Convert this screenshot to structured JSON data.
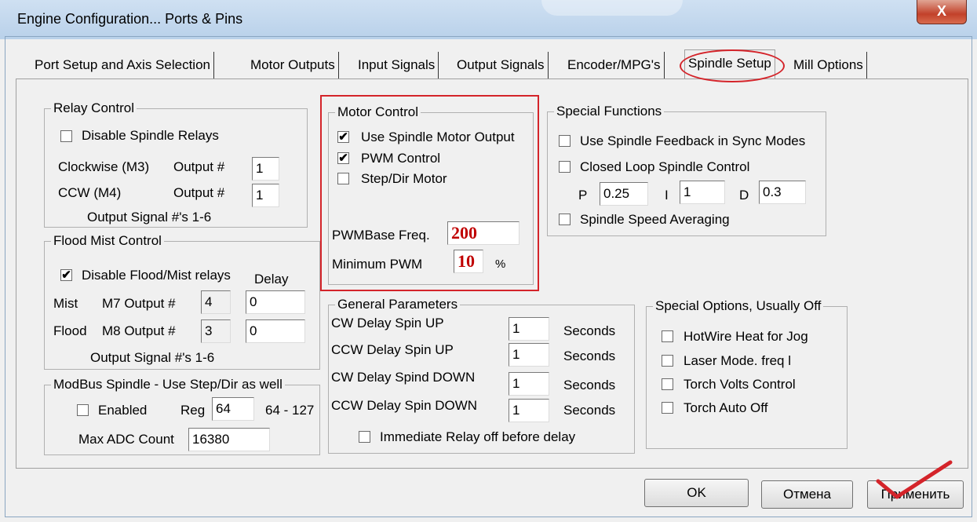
{
  "window": {
    "title": "Engine Configuration... Ports & Pins",
    "close_glyph": "X"
  },
  "tabs": [
    {
      "label": "Port Setup and Axis Selection"
    },
    {
      "label": "Motor Outputs"
    },
    {
      "label": "Input Signals"
    },
    {
      "label": "Output Signals"
    },
    {
      "label": "Encoder/MPG's"
    },
    {
      "label": "Spindle Setup",
      "active": true
    },
    {
      "label": "Mill Options"
    }
  ],
  "relay_control": {
    "title": "Relay Control",
    "disable_spindle_relays": {
      "label": "Disable Spindle Relays",
      "checked": false
    },
    "clockwise": {
      "label": "Clockwise (M3)",
      "output_label": "Output #",
      "value": "1"
    },
    "ccw": {
      "label": "CCW (M4)",
      "output_label": "Output #",
      "value": "1"
    },
    "note": "Output Signal #'s 1-6"
  },
  "flood_mist_control": {
    "title": "Flood Mist Control",
    "disable_relays": {
      "label": "Disable Flood/Mist relays",
      "checked": true
    },
    "delay_header": "Delay",
    "mist": {
      "label": "Mist",
      "output_label": "M7 Output #",
      "output": "4",
      "delay": "0"
    },
    "flood": {
      "label": "Flood",
      "output_label": "M8 Output #",
      "output": "3",
      "delay": "0"
    },
    "note": "Output Signal #'s 1-6"
  },
  "modbus_spindle": {
    "title": "ModBus Spindle - Use Step/Dir as well",
    "enabled": {
      "label": "Enabled",
      "checked": false
    },
    "reg_label": "Reg",
    "reg_value": "64",
    "reg_range": "64 - 127",
    "max_adc_label": "Max ADC Count",
    "max_adc_value": "16380"
  },
  "motor_control": {
    "title": "Motor Control",
    "use_spindle_motor_output": {
      "label": "Use Spindle Motor Output",
      "checked": true
    },
    "pwm_control": {
      "label": "PWM Control",
      "checked": true
    },
    "step_dir_motor": {
      "label": "Step/Dir Motor",
      "checked": false
    },
    "pwm_base_freq": {
      "label": "PWMBase Freq.",
      "value": "200"
    },
    "minimum_pwm": {
      "label": "Minimum PWM",
      "value": "10",
      "unit": "%"
    }
  },
  "general_parameters": {
    "title": "General Parameters",
    "rows": [
      {
        "label": "CW Delay Spin UP",
        "value": "1",
        "unit": "Seconds"
      },
      {
        "label": "CCW Delay Spin UP",
        "value": "1",
        "unit": "Seconds"
      },
      {
        "label": "CW Delay Spind DOWN",
        "value": "1",
        "unit": "Seconds"
      },
      {
        "label": "CCW Delay Spin DOWN",
        "value": "1",
        "unit": "Seconds"
      }
    ],
    "immediate_relay_off": {
      "label": "Immediate Relay off before delay",
      "checked": false
    }
  },
  "special_functions": {
    "title": "Special Functions",
    "sync_feedback": {
      "label": "Use Spindle Feedback in Sync Modes",
      "checked": false
    },
    "closed_loop": {
      "label": "Closed Loop Spindle Control",
      "checked": false
    },
    "p_label": "P",
    "p_value": "0.25",
    "i_label": "I",
    "i_value": "1",
    "d_label": "D",
    "d_value": "0.3",
    "speed_averaging": {
      "label": "Spindle Speed Averaging",
      "checked": false
    }
  },
  "special_options": {
    "title": "Special Options, Usually Off",
    "items": [
      {
        "label": "HotWire Heat for Jog",
        "checked": false
      },
      {
        "label": "Laser Mode. freq l",
        "checked": false
      },
      {
        "label": "Torch Volts Control",
        "checked": false
      },
      {
        "label": "Torch Auto Off",
        "checked": false
      }
    ]
  },
  "buttons": {
    "ok": "OK",
    "cancel": "Отмена",
    "apply": "Применить"
  },
  "annotation_color": "#d4242a"
}
